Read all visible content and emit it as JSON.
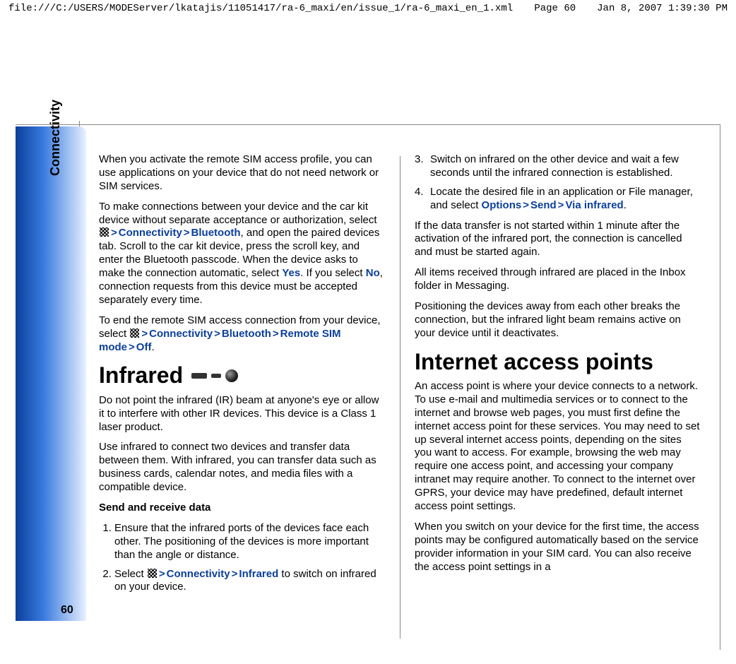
{
  "topbar": {
    "path": "file:///C:/USERS/MODEServer/lkatajis/11051417/ra-6_maxi/en/issue_1/ra-6_maxi_en_1.xml",
    "page": "Page 60",
    "timestamp": "Jan 8, 2007 1:39:30 PM"
  },
  "spine": {
    "section": "Connectivity",
    "page_number": "60"
  },
  "left": {
    "p1": "When you activate the remote SIM access profile, you can use applications on your device that do not need network or SIM services.",
    "p2a": "To make connections between your device and the car kit device without separate acceptance or authorization, select ",
    "p2_menu1": "Connectivity",
    "p2_menu2": "Bluetooth",
    "p2b": ", and open the paired devices tab. Scroll to the car kit device, press the scroll key, and enter the Bluetooth passcode. When the device asks to make the connection automatic, select ",
    "p2_yes": "Yes",
    "p2c": ". If you select ",
    "p2_no": "No",
    "p2d": ", connection requests from this device must be accepted separately every time.",
    "p3a": "To end the remote SIM access connection from your device, select ",
    "p3_menu1": "Connectivity",
    "p3_menu2": "Bluetooth",
    "p3_menu3": "Remote SIM mode",
    "p3_menu4": "Off",
    "h1": "Infrared",
    "p4": "Do not point the infrared (IR) beam at anyone's eye or allow it to interfere with other IR devices. This device is a Class 1 laser product.",
    "p5": "Use infrared to connect two devices and transfer data between them. With infrared, you can transfer data such as business cards, calendar notes, and media files with a compatible device.",
    "sub": "Send and receive data",
    "li1": "Ensure that the infrared ports of the devices face each other. The positioning of the devices is more important than the angle or distance.",
    "li2a": "Select ",
    "li2_menu1": "Connectivity",
    "li2_menu2": "Infrared",
    "li2b": " to switch on infrared on your device."
  },
  "right": {
    "li3": "Switch on infrared on the other device and wait a few seconds until the infrared connection is established.",
    "li4a": "Locate the desired file in an application or File manager, and select ",
    "li4_menu1": "Options",
    "li4_menu2": "Send",
    "li4_menu3": "Via infrared",
    "p1": "If the data transfer is not started within 1 minute after the activation of the infrared port, the connection is cancelled and must be started again.",
    "p2": "All items received through infrared are placed in the Inbox folder in Messaging.",
    "p3": "Positioning the devices away from each other breaks the connection, but the infrared light beam remains active on your device until it deactivates.",
    "h1": "Internet access points",
    "p4": "An access point is where your device connects to a network. To use e-mail and multimedia services or to connect to the internet and browse web pages, you must first define the internet access point for these services. You may need to set up several internet access points, depending on the sites you want to access. For example, browsing the web may require one access point, and accessing your company intranet may require another. To connect to the internet over GPRS, your device may have predefined, default internet access point settings.",
    "p5": "When you switch on your device for the first time, the access points may be configured automatically based on the service provider information in your SIM card. You can also receive the access point settings in a"
  }
}
